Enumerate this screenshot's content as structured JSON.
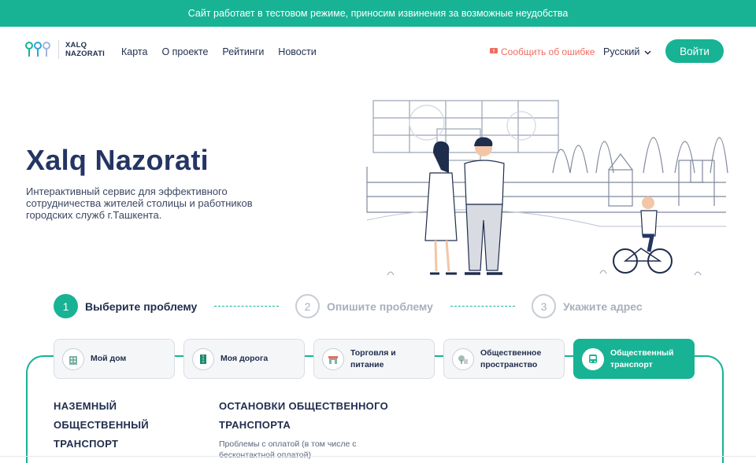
{
  "banner": {
    "text": "Сайт работает в тестовом режиме, приносим извинения за возможные неудобства"
  },
  "header": {
    "logo_line1": "XALQ",
    "logo_line2": "NAZORATI",
    "nav": [
      "Карта",
      "О проекте",
      "Рейтинги",
      "Новости"
    ],
    "report_error": "Сообщить об ошибке",
    "language": "Русский",
    "login": "Войти"
  },
  "hero": {
    "title": "Xalq Nazorati",
    "description": "Интерактивный сервис для эффективного сотрудничества жителей столицы и работников городских служб г.Ташкента."
  },
  "steps": [
    {
      "num": "1",
      "label": "Выберите проблему"
    },
    {
      "num": "2",
      "label": "Опишите проблему"
    },
    {
      "num": "3",
      "label": "Укажите адрес"
    }
  ],
  "categories": [
    {
      "line1": "Мой дом",
      "line2": "",
      "icon": "house-icon"
    },
    {
      "line1": "Моя дорога",
      "line2": "",
      "icon": "road-icon"
    },
    {
      "line1": "Торговля и",
      "line2": "питание",
      "icon": "shop-icon"
    },
    {
      "line1": "Общественное",
      "line2": "пространство",
      "icon": "park-icon"
    },
    {
      "line1": "Общественный",
      "line2": "транспорт",
      "icon": "bus-icon"
    }
  ],
  "subcategory": {
    "left_lines": [
      "НАЗЕМНЫЙ",
      "ОБЩЕСТВЕННЫЙ",
      "ТРАНСПОРТ"
    ],
    "right_title_lines": [
      "ОСТАНОВКИ ОБЩЕСТВЕННОГО",
      "ТРАНСПОРТА"
    ],
    "right_desc": "Проблемы с оплатой (в том числе с бесконтактной оплатой)"
  },
  "colors": {
    "accent": "#17b394",
    "text": "#1f2d4d",
    "error": "#ef6b5e"
  }
}
